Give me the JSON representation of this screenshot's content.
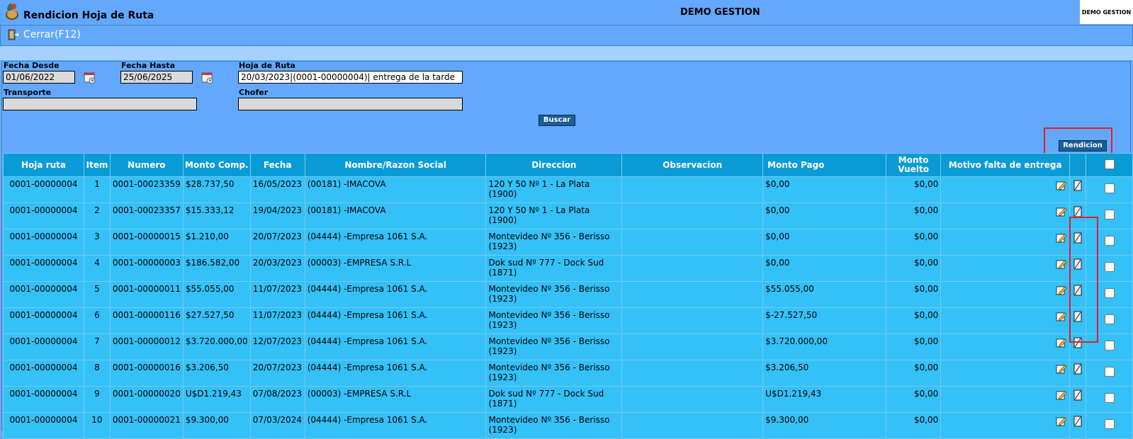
{
  "header": {
    "title": "Rendicion Hoja de Ruta",
    "company": "DEMO GESTION",
    "logo_text": "DEMO GESTION"
  },
  "toolbar": {
    "close_label": "Cerrar(F12)"
  },
  "filters": {
    "fecha_desde": {
      "label": "Fecha Desde",
      "value": "01/06/2022"
    },
    "fecha_hasta": {
      "label": "Fecha Hasta",
      "value": "25/06/2025"
    },
    "hoja_ruta": {
      "label": "Hoja de Ruta",
      "value": "20/03/2023|(0001-00000004)| entrega de la tarde"
    },
    "transporte": {
      "label": "Transporte",
      "value": ""
    },
    "chofer": {
      "label": "Chofer",
      "value": ""
    },
    "buscar_label": "Buscar",
    "rendicion_label": "Rendicion"
  },
  "table": {
    "headers": [
      "Hoja ruta",
      "Item",
      "Numero",
      "Monto Comp.",
      "Fecha",
      "Nombre/Razon Social",
      "Direccion",
      "Observacion",
      "Monto Pago",
      "Monto Vuelto",
      "Motivo falta de entrega",
      "",
      ""
    ],
    "rows": [
      {
        "hoja": "0001-00000004",
        "item": "1",
        "numero": "0001-00023359",
        "monto": "$28.737,50",
        "fecha": "16/05/2023",
        "nombre": "(00181) -IMACOVA",
        "dir1": "120 Y 50 Nº 1 - La Plata",
        "dir2": "(1900)",
        "obs": "",
        "pago": "$0,00",
        "vuelto": "$0,00",
        "motivo": ""
      },
      {
        "hoja": "0001-00000004",
        "item": "2",
        "numero": "0001-00023357",
        "monto": "$15.333,12",
        "fecha": "19/04/2023",
        "nombre": "(00181) -IMACOVA",
        "dir1": "120 Y 50 Nº 1 - La Plata",
        "dir2": "(1900)",
        "obs": "",
        "pago": "$0,00",
        "vuelto": "$0,00",
        "motivo": ""
      },
      {
        "hoja": "0001-00000004",
        "item": "3",
        "numero": "0001-00000015",
        "monto": "$1.210,00",
        "fecha": "20/07/2023",
        "nombre": "(04444) -Empresa 1061 S.A.",
        "dir1": "Montevideo Nº 356 - Berisso",
        "dir2": "(1923)",
        "obs": "",
        "pago": "$0,00",
        "vuelto": "$0,00",
        "motivo": ""
      },
      {
        "hoja": "0001-00000004",
        "item": "4",
        "numero": "0001-00000003",
        "monto": "$186.582,00",
        "fecha": "20/03/2023",
        "nombre": "(00003) -EMPRESA S.R.L",
        "dir1": "Dok sud Nº 777 - Dock Sud",
        "dir2": "(1871)",
        "obs": "",
        "pago": "$0,00",
        "vuelto": "$0,00",
        "motivo": ""
      },
      {
        "hoja": "0001-00000004",
        "item": "5",
        "numero": "0001-00000011",
        "monto": "$55.055,00",
        "fecha": "11/07/2023",
        "nombre": "(04444) -Empresa 1061 S.A.",
        "dir1": "Montevideo Nº 356 - Berisso",
        "dir2": "(1923)",
        "obs": "",
        "pago": "$55.055,00",
        "vuelto": "$0,00",
        "motivo": ""
      },
      {
        "hoja": "0001-00000004",
        "item": "6",
        "numero": "0001-00000116",
        "monto": "$27.527,50",
        "fecha": "11/07/2023",
        "nombre": "(04444) -Empresa 1061 S.A.",
        "dir1": "Montevideo Nº 356 - Berisso",
        "dir2": "(1923)",
        "obs": "",
        "pago": "$-27.527,50",
        "vuelto": "$0,00",
        "motivo": ""
      },
      {
        "hoja": "0001-00000004",
        "item": "7",
        "numero": "0001-00000012",
        "monto": "$3.720.000,00",
        "fecha": "12/07/2023",
        "nombre": "(04444) -Empresa 1061 S.A.",
        "dir1": "Montevideo Nº 356 - Berisso",
        "dir2": "(1923)",
        "obs": "",
        "pago": "$3.720.000,00",
        "vuelto": "$0,00",
        "motivo": ""
      },
      {
        "hoja": "0001-00000004",
        "item": "8",
        "numero": "0001-00000016",
        "monto": "$3.206,50",
        "fecha": "20/07/2023",
        "nombre": "(04444) -Empresa 1061 S.A.",
        "dir1": "Montevideo Nº 356 - Berisso",
        "dir2": "(1923)",
        "obs": "",
        "pago": "$3.206,50",
        "vuelto": "$0,00",
        "motivo": ""
      },
      {
        "hoja": "0001-00000004",
        "item": "9",
        "numero": "0001-00000020",
        "monto": "U$D1.219,43",
        "fecha": "07/08/2023",
        "nombre": "(00003) -EMPRESA S.R.L",
        "dir1": "Dok sud Nº 777 - Dock Sud",
        "dir2": "(1871)",
        "obs": "",
        "pago": "U$D1.219,43",
        "vuelto": "$0,00",
        "motivo": ""
      },
      {
        "hoja": "0001-00000004",
        "item": "10",
        "numero": "0001-00000021",
        "monto": "$9.300,00",
        "fecha": "07/03/2024",
        "nombre": "(04444) -Empresa 1061 S.A.",
        "dir1": "Montevideo Nº 356 - Berisso",
        "dir2": "(1923)",
        "obs": "",
        "pago": "$9.300,00",
        "vuelto": "$0,00",
        "motivo": ""
      }
    ]
  },
  "colors": {
    "page_bg": "#6aaaf0",
    "header_cell": "#0a9bd6",
    "row_cell": "#33c1f8",
    "highlight": "#e0202a",
    "button": "#1c5e96"
  }
}
